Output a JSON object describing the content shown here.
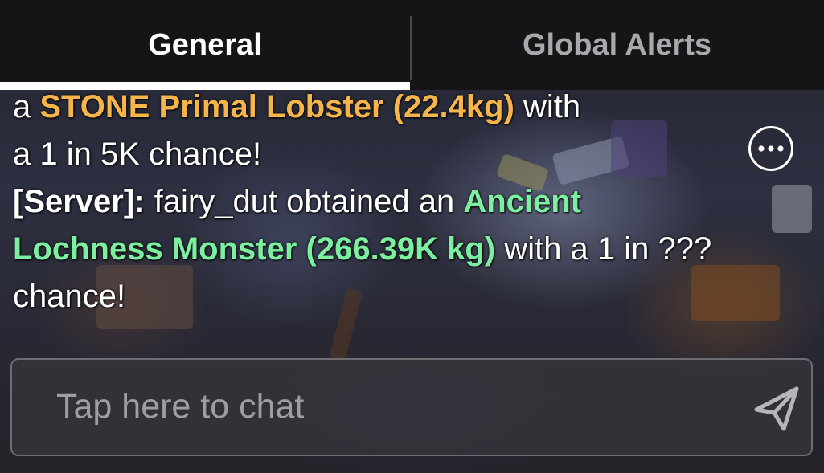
{
  "tabs": {
    "general_label": "General",
    "global_alerts_label": "Global Alerts",
    "active": "General"
  },
  "chat": {
    "line1": {
      "prefix": "a ",
      "highlight": "STONE Primal Lobster (22.4kg)",
      "suffix": " with"
    },
    "line2": "a 1 in 5K chance!",
    "message2": {
      "sender": "[Server]:",
      "text_before": " fairy_dut obtained an ",
      "highlight": "Ancient Lochness Monster (266.39K kg)",
      "text_after": " with a 1 in ??? chance!"
    }
  },
  "more_options": {
    "icon": "ellipsis-icon"
  },
  "input": {
    "placeholder": "Tap here to chat",
    "send_icon": "send-icon"
  },
  "colors": {
    "highlight_orange": "#f6b54a",
    "highlight_green": "#7cf0a0",
    "tabbar_bg": "#151517"
  }
}
